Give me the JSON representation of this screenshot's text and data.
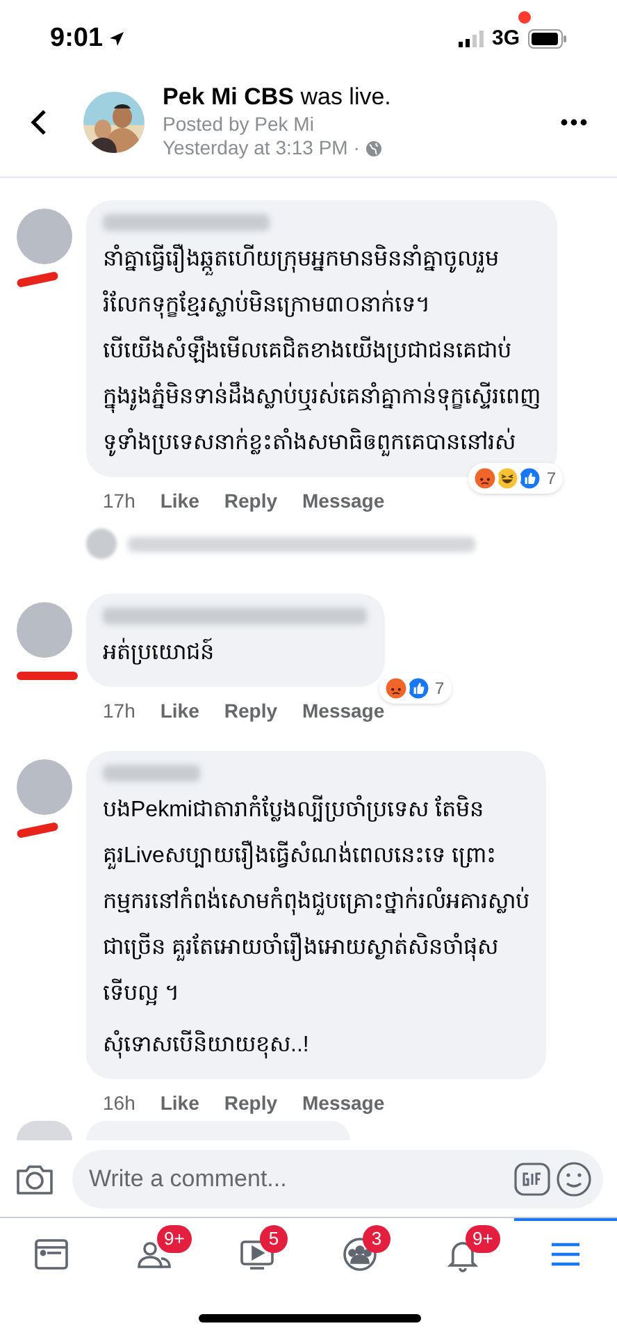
{
  "status_bar": {
    "time": "9:01",
    "network": "3G"
  },
  "header": {
    "title": "**Pek Mi CBS** was live.",
    "posted_by": "Posted by Pek Mi",
    "time": "Yesterday at 3:13 PM ·"
  },
  "comments": [
    {
      "text": [
        "នាំគ្នាធ្វើរឿងឆ្កួតហើយក្រុមអ្នកមានមិននាំគ្នាចូលរួម\nរំលែកទុក្ខខ្មែរស្លាប់មិនក្រោម៣០នាក់ទេ។\nបើយើងសំឡឹងមើលគេជិតខាងយើងប្រជាជនគេជាប់\nក្នុងរូងភ្នំមិនទាន់ដឹងស្លាប់ឬរស់គេនាំគ្នាកាន់ទុក្ខស្ទើរពេញ\nទូទាំងប្រទេសនាក់ខ្លះតាំងសមាធិឲពួកគេបាននៅរស់"
      ],
      "time": "17h",
      "actions": [
        "Like",
        "Reply",
        "Message"
      ],
      "reactions": [
        {
          "kind": "angry"
        },
        {
          "kind": "haha"
        },
        {
          "kind": "like"
        }
      ],
      "reaction_count": "7",
      "has_replies": true
    },
    {
      "text": [
        "អត់ប្រយោជន៍"
      ],
      "time": "17h",
      "actions": [
        "Like",
        "Reply",
        "Message"
      ],
      "reactions": [
        {
          "kind": "angry"
        },
        {
          "kind": "like"
        }
      ],
      "reaction_count": "7"
    },
    {
      "text": [
        "បងPekmiជាតារាកំប្លែងល្បីប្រចាំប្រទេស តែមិន\nគួរLiveសប្បាយរឿងធ្វើសំណង់ពេលនេះទេ ព្រោះ\nកម្មករនៅកំពង់សោមកំពុងជួបគ្រោះថ្នាក់រលំអគារស្លាប់\nជាច្រើន គួរតែអោយចាំរឿងអោយស្ងាត់សិនចាំផុស\nទើបល្អ ។",
        "សុំទោសបើនិយាយខុស..!"
      ],
      "time": "16h",
      "actions": [
        "Like",
        "Reply",
        "Message"
      ]
    }
  ],
  "composer": {
    "placeholder": "Write a comment..."
  },
  "nav": [
    {
      "kind": "feed",
      "selected": false
    },
    {
      "kind": "friends",
      "badge": "9+",
      "selected": false
    },
    {
      "kind": "watch",
      "badge": "5",
      "selected": false
    },
    {
      "kind": "groups",
      "badge": "3",
      "selected": false
    },
    {
      "kind": "bell",
      "badge": "9+",
      "selected": false
    },
    {
      "kind": "menu",
      "selected": true
    }
  ]
}
